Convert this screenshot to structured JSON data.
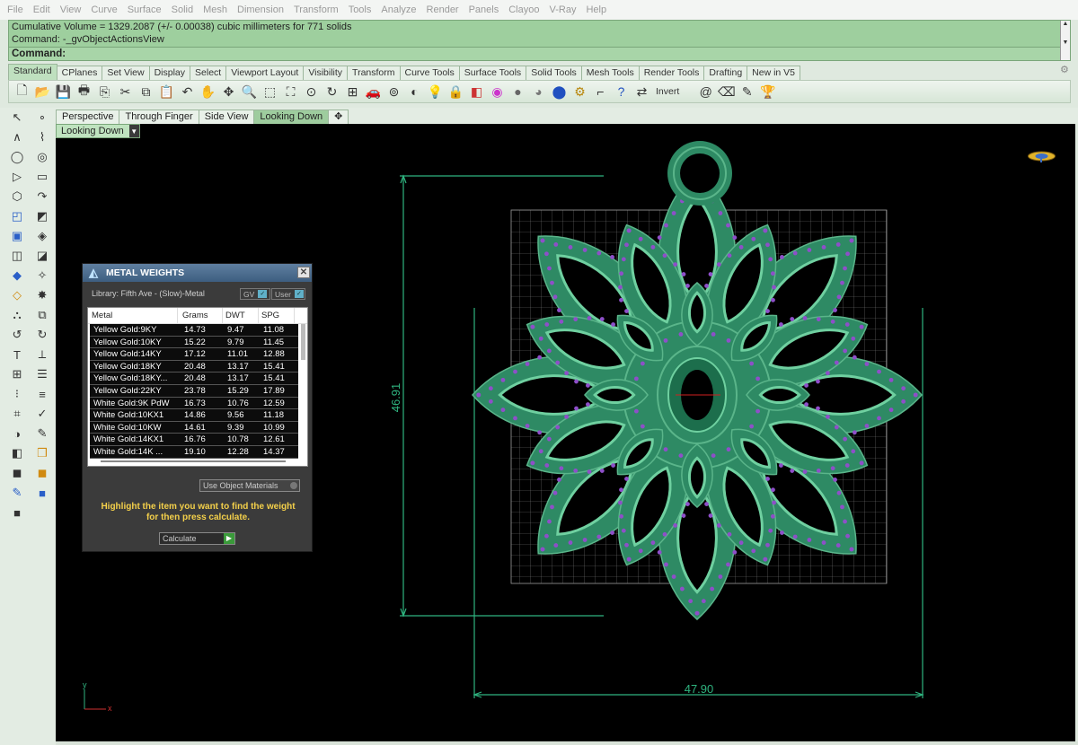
{
  "menubar": {
    "items": [
      "File",
      "Edit",
      "View",
      "Curve",
      "Surface",
      "Solid",
      "Mesh",
      "Dimension",
      "Transform",
      "Tools",
      "Analyze",
      "Render",
      "Panels",
      "Clayoo",
      "V-Ray",
      "Help"
    ]
  },
  "command": {
    "history_line_1": "Cumulative Volume = 1329.2087 (+/- 0.00038) cubic millimeters for 771 solids",
    "history_line_2": "Command: -_gvObjectActionsView",
    "prompt": "Command:"
  },
  "toolbar_tabs": [
    "Standard",
    "CPlanes",
    "Set View",
    "Display",
    "Select",
    "Viewport Layout",
    "Visibility",
    "Transform",
    "Curve Tools",
    "Surface Tools",
    "Solid Tools",
    "Mesh Tools",
    "Render Tools",
    "Drafting",
    "New in V5"
  ],
  "toolbar": {
    "icons": [
      "new-file-icon",
      "open-folder-icon",
      "save-icon",
      "print-icon",
      "import-icon",
      "cut-icon",
      "copy-icon",
      "paste-icon",
      "undo-icon",
      "pan-icon",
      "move-view-icon",
      "zoom-icon",
      "zoom-window-icon",
      "zoom-extents-icon",
      "zoom-selected-icon",
      "rotate-view-icon",
      "four-viewports-icon",
      "car-icon",
      "named-views-icon",
      "ghosted-icon",
      "bulb-icon",
      "lock-icon",
      "layers-icon",
      "color-wheel-icon",
      "shaded-sphere-icon",
      "rendered-sphere-icon",
      "render-sphere-icon",
      "options-gear-icon",
      "dimension-icon",
      "help-icon",
      "swap-icon"
    ],
    "invert_label": "Invert",
    "trailing_icons": [
      "spiral-icon",
      "eraser-icon",
      "pen-icon",
      "trophy-icon"
    ]
  },
  "sidebar": {
    "icons": [
      [
        "select-arrow-icon",
        "point-icon"
      ],
      [
        "polyline-icon",
        "curve-pts-icon"
      ],
      [
        "circle-icon",
        "ellipse-icon"
      ],
      [
        "arc-icon",
        "rectangle-icon"
      ],
      [
        "polygon-icon",
        "fillet-icon"
      ],
      [
        "surface-icon",
        "extrude-icon"
      ],
      [
        "box-icon",
        "sweep-icon"
      ],
      [
        "plane-icon",
        "patch-icon"
      ],
      [
        "solid-edit-icon",
        "boolean-icon"
      ],
      [
        "explode-icon",
        "split-icon"
      ],
      [
        "trim-icon",
        "join-icon"
      ],
      [
        "group-icon",
        "scale-icon"
      ],
      [
        "fillet-edge-icon",
        "offset-icon"
      ],
      [
        "text-icon",
        "dimension-vert-icon"
      ],
      [
        "array-icon",
        "rotate-icon"
      ],
      [
        "grid-array-icon",
        "distribute-icon"
      ],
      [
        "analyze-icon",
        "check-icon"
      ],
      [
        "mesh-icon",
        "paint-icon"
      ],
      [
        "hide-icon",
        "render-icon"
      ],
      [
        "cube-blue-icon",
        "cube-blue2-icon"
      ],
      [
        "notes-icon",
        ""
      ]
    ]
  },
  "viewport_tabs": [
    "Perspective",
    "Through Finger",
    "Side View",
    "Looking Down"
  ],
  "viewport_tabs_active": "Looking Down",
  "viewport": {
    "label": "Looking Down",
    "dim_vertical": "46.91",
    "dim_horizontal": "47.90",
    "axis_y": "y",
    "axis_x": "x"
  },
  "metal_panel": {
    "title": "METAL WEIGHTS",
    "library": "Library: Fifth Ave - (Slow)-Metal",
    "gv_label": "GV",
    "user_label": "User",
    "columns": [
      "Metal",
      "Grams",
      "DWT",
      "SPG"
    ],
    "rows": [
      [
        "Yellow Gold:9KY",
        "14.73",
        "9.47",
        "11.08"
      ],
      [
        "Yellow Gold:10KY",
        "15.22",
        "9.79",
        "11.45"
      ],
      [
        "Yellow Gold:14KY",
        "17.12",
        "11.01",
        "12.88"
      ],
      [
        "Yellow Gold:18KY",
        "20.48",
        "13.17",
        "15.41"
      ],
      [
        "Yellow Gold:18KY...",
        "20.48",
        "13.17",
        "15.41"
      ],
      [
        "Yellow Gold:22KY",
        "23.78",
        "15.29",
        "17.89"
      ],
      [
        "White Gold:9K PdW",
        "16.73",
        "10.76",
        "12.59"
      ],
      [
        "White Gold:10KX1",
        "14.86",
        "9.56",
        "11.18"
      ],
      [
        "White Gold:10KW",
        "14.61",
        "9.39",
        "10.99"
      ],
      [
        "White Gold:14KX1",
        "16.76",
        "10.78",
        "12.61"
      ],
      [
        "White Gold:14K ...",
        "19.10",
        "12.28",
        "14.37"
      ]
    ],
    "use_materials": "Use Object Materials",
    "instruction_1": "Highlight the item you want to find the weight",
    "instruction_2": "for then press calculate.",
    "calculate": "Calculate"
  },
  "colors": {
    "command_bg": "#9ecf9e",
    "viewport_bg": "#000000",
    "pendant_green": "#2e8a64",
    "stone_purple": "#8e4fc9",
    "dimension_line": "#2fb37f"
  }
}
